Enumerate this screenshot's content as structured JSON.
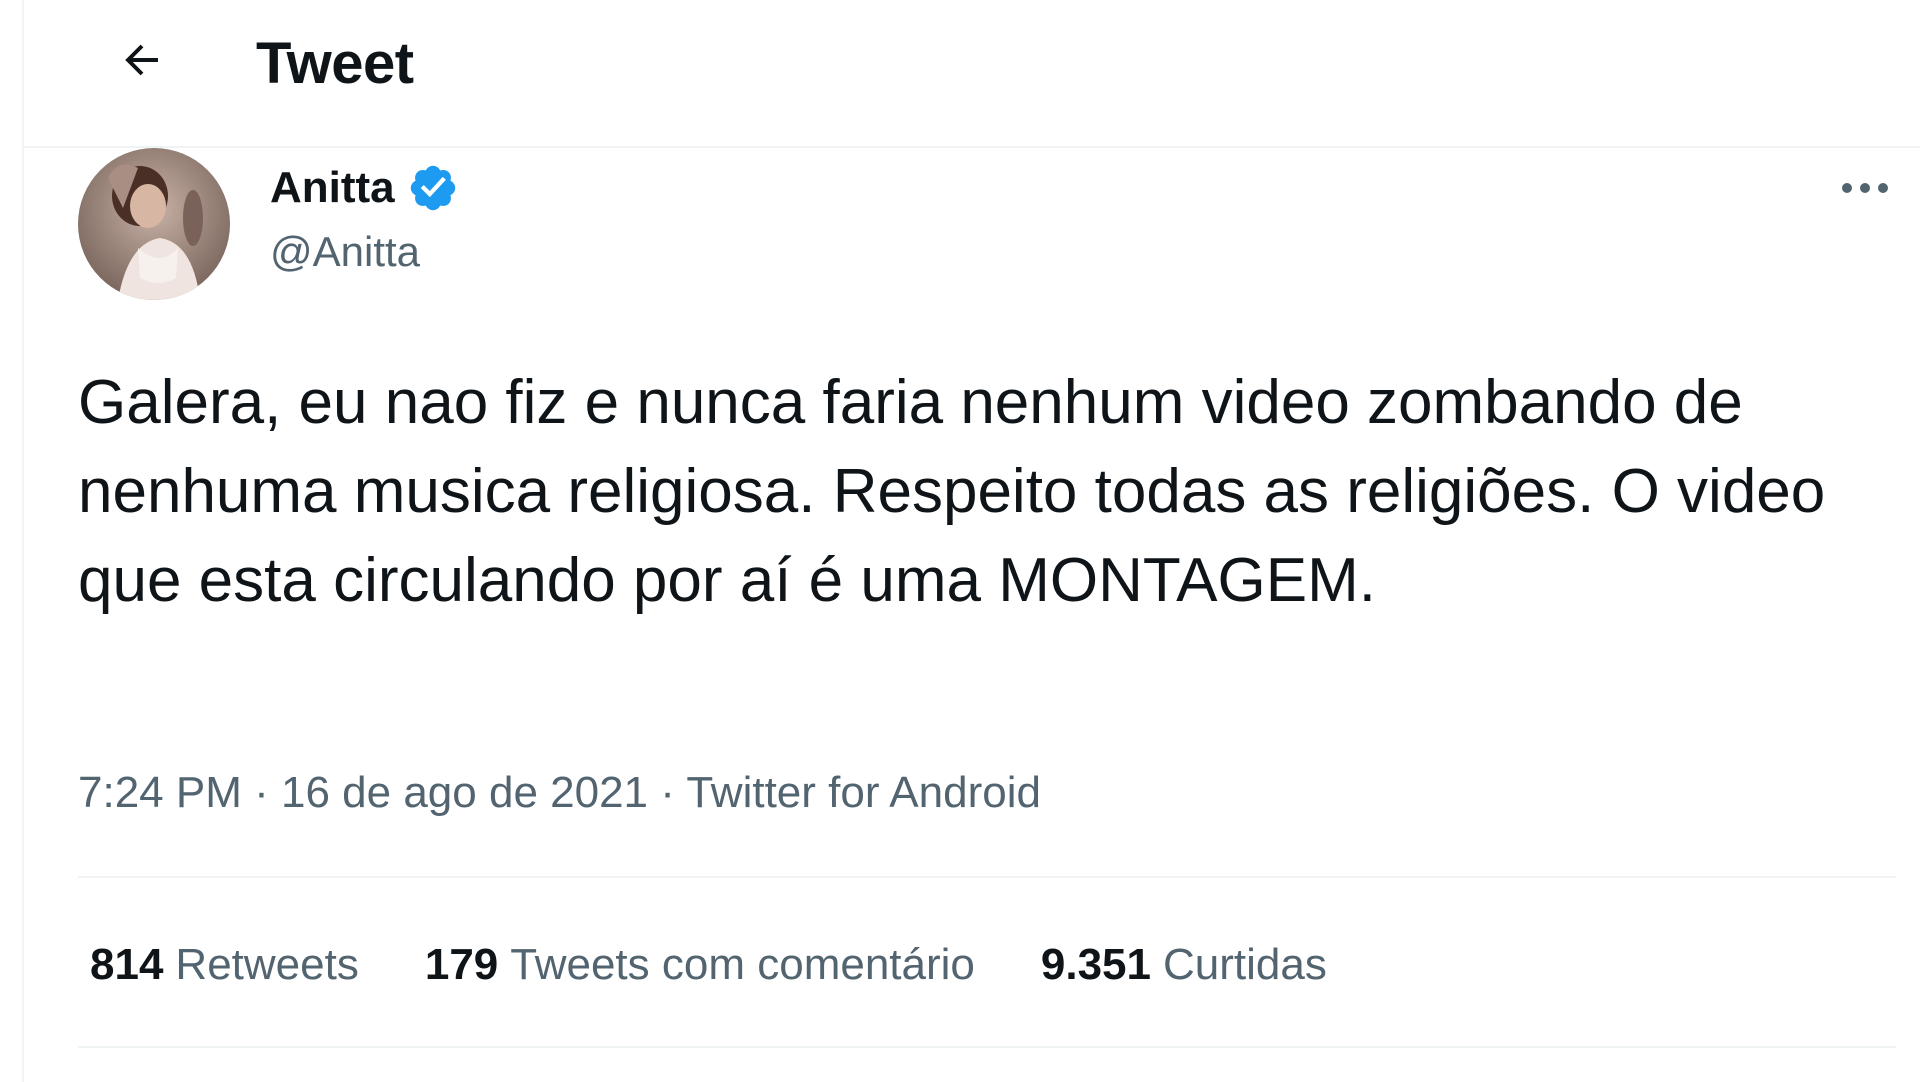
{
  "header": {
    "back_icon": "arrow-left-icon",
    "title": "Tweet"
  },
  "tweet": {
    "author": {
      "name": "Anitta",
      "handle": "@Anitta",
      "verified_icon": "verified-badge-icon",
      "verified_color": "#1d9bf0"
    },
    "more_icon": "more-horizontal-icon",
    "text": "Galera, eu nao fiz e nunca faria nenhum video zombando de nenhuma musica religiosa. Respeito todas as religiões. O video que esta circulando por aí é uma MONTAGEM.",
    "time": "7:24 PM",
    "date": "16 de ago de 2021",
    "source": "Twitter for Android",
    "separator": "·",
    "stats": {
      "retweets": {
        "count": "814",
        "label": "Retweets"
      },
      "quotes": {
        "count": "179",
        "label": "Tweets com comentário"
      },
      "likes": {
        "count": "9.351",
        "label": "Curtidas"
      }
    }
  },
  "colors": {
    "text_primary": "#0f1419",
    "text_secondary": "#536471",
    "divider": "#eff3f4"
  }
}
